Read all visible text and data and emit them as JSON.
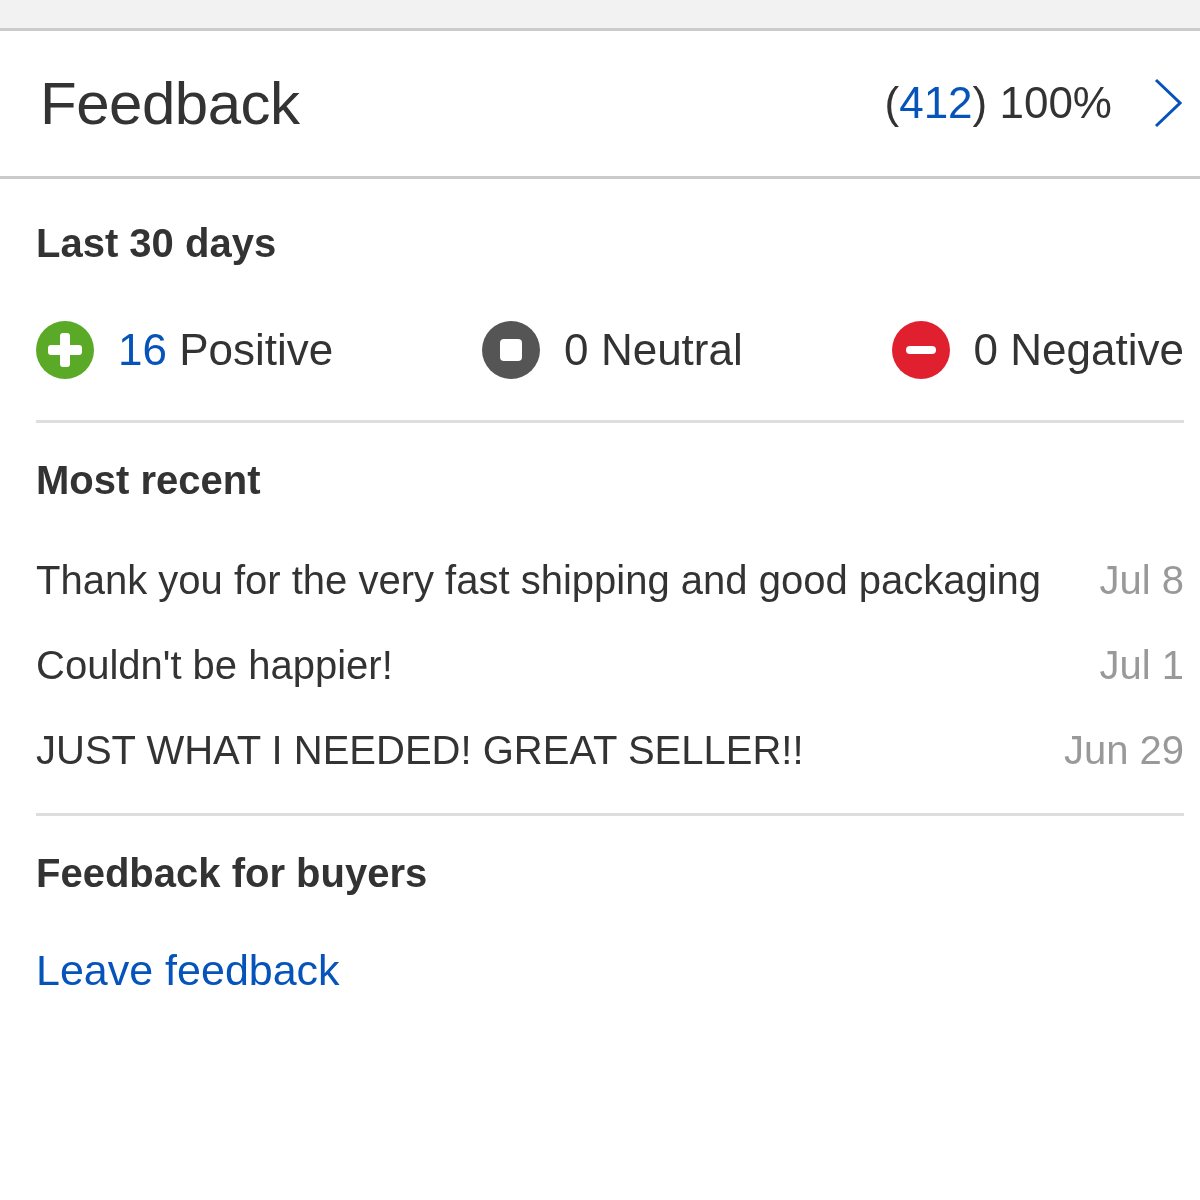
{
  "header": {
    "title": "Feedback",
    "score": {
      "before": "(",
      "count": "412",
      "after": ")",
      "percentage": "100%"
    }
  },
  "last_30_days": {
    "heading": "Last 30 days",
    "ratings": [
      {
        "kind": "positive",
        "color": "#5aa927",
        "count": "16",
        "linked": true,
        "label": "Positive"
      },
      {
        "kind": "neutral",
        "color": "#555555",
        "count": "0",
        "linked": false,
        "label": "Neutral"
      },
      {
        "kind": "negative",
        "color": "#e0202f",
        "count": "0",
        "linked": false,
        "label": "Negative"
      }
    ]
  },
  "most_recent": {
    "heading": "Most recent",
    "items": [
      {
        "comment": "Thank you for the very fast shipping and good packaging",
        "date": "Jul 8"
      },
      {
        "comment": "Couldn't be happier!",
        "date": "Jul 1"
      },
      {
        "comment": "JUST WHAT I NEEDED! GREAT SELLER!!",
        "date": "Jun 29"
      }
    ]
  },
  "feedback_for_buyers": {
    "heading": "Feedback for buyers",
    "link": "Leave feedback"
  }
}
